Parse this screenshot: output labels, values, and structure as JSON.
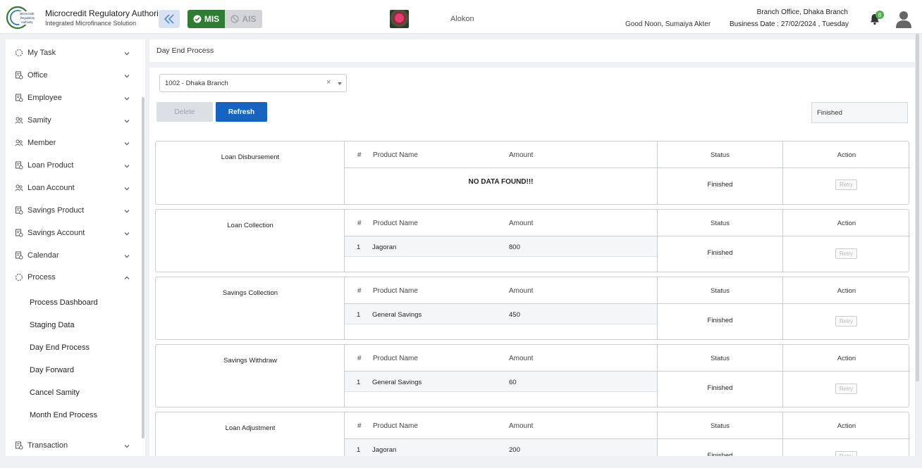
{
  "header": {
    "app_title": "Microcredit Regulatory Authority",
    "app_subtitle": "Integrated Microfinance Solution",
    "logo_text": "Microcredit Regulatory Authority",
    "mode_mis": "MIS",
    "mode_ais": "AIS",
    "org_name": "Alokon",
    "greeting": "Good Noon, Sumaiya Akter",
    "branch_office": "Branch Office, Dhaka Branch",
    "business_date": "Business Date : 27/02/2024 , Tuesday",
    "notification_count": "8",
    "colors": {
      "mis_green": "#2e7d32",
      "badge_green": "#4caf50",
      "primary_blue": "#1565c0"
    }
  },
  "sidebar": {
    "items": [
      {
        "label": "My Task",
        "icon": "circle-dashed-icon"
      },
      {
        "label": "Office",
        "icon": "doc-gear-icon"
      },
      {
        "label": "Employee",
        "icon": "doc-gear-icon"
      },
      {
        "label": "Samity",
        "icon": "users-icon"
      },
      {
        "label": "Member",
        "icon": "users-icon"
      },
      {
        "label": "Loan Product",
        "icon": "doc-gear-icon"
      },
      {
        "label": "Loan Account",
        "icon": "users-icon"
      },
      {
        "label": "Savings Product",
        "icon": "doc-gear-icon"
      },
      {
        "label": "Savings Account",
        "icon": "doc-gear-icon"
      },
      {
        "label": "Calendar",
        "icon": "doc-gear-icon"
      },
      {
        "label": "Process",
        "icon": "circle-dashed-icon"
      }
    ],
    "process_sub": [
      "Process Dashboard",
      "Staging Data",
      "Day End Process",
      "Day Forward",
      "Cancel Samity",
      "Month End Process"
    ],
    "transaction": {
      "label": "Transaction",
      "icon": "doc-gear-icon"
    }
  },
  "main": {
    "breadcrumb": "Day End Process",
    "branch_select": "1002 - Dhaka Branch",
    "clear_symbol": "×",
    "delete_label": "Delete",
    "refresh_label": "Refresh",
    "status_value": "Finished",
    "columns": {
      "num": "#",
      "product": "Product Name",
      "amount": "Amount",
      "status": "Status",
      "action": "Action"
    },
    "no_data": "NO DATA FOUND!!!",
    "retry_label": "Retry",
    "blocks": [
      {
        "title": "Loan Disbursement",
        "status": "Finished",
        "rows": []
      },
      {
        "title": "Loan Collection",
        "status": "Finished",
        "rows": [
          {
            "num": "1",
            "product": "Jagoran",
            "amount": "800"
          }
        ]
      },
      {
        "title": "Savings Collection",
        "status": "Finished",
        "rows": [
          {
            "num": "1",
            "product": "General Savings",
            "amount": "450"
          }
        ]
      },
      {
        "title": "Savings Withdraw",
        "status": "Finished",
        "rows": [
          {
            "num": "1",
            "product": "General Savings",
            "amount": "60"
          }
        ]
      },
      {
        "title": "Loan Adjustment",
        "status": "Finished",
        "rows": [
          {
            "num": "1",
            "product": "Jagoran",
            "amount": "200"
          }
        ]
      }
    ]
  }
}
